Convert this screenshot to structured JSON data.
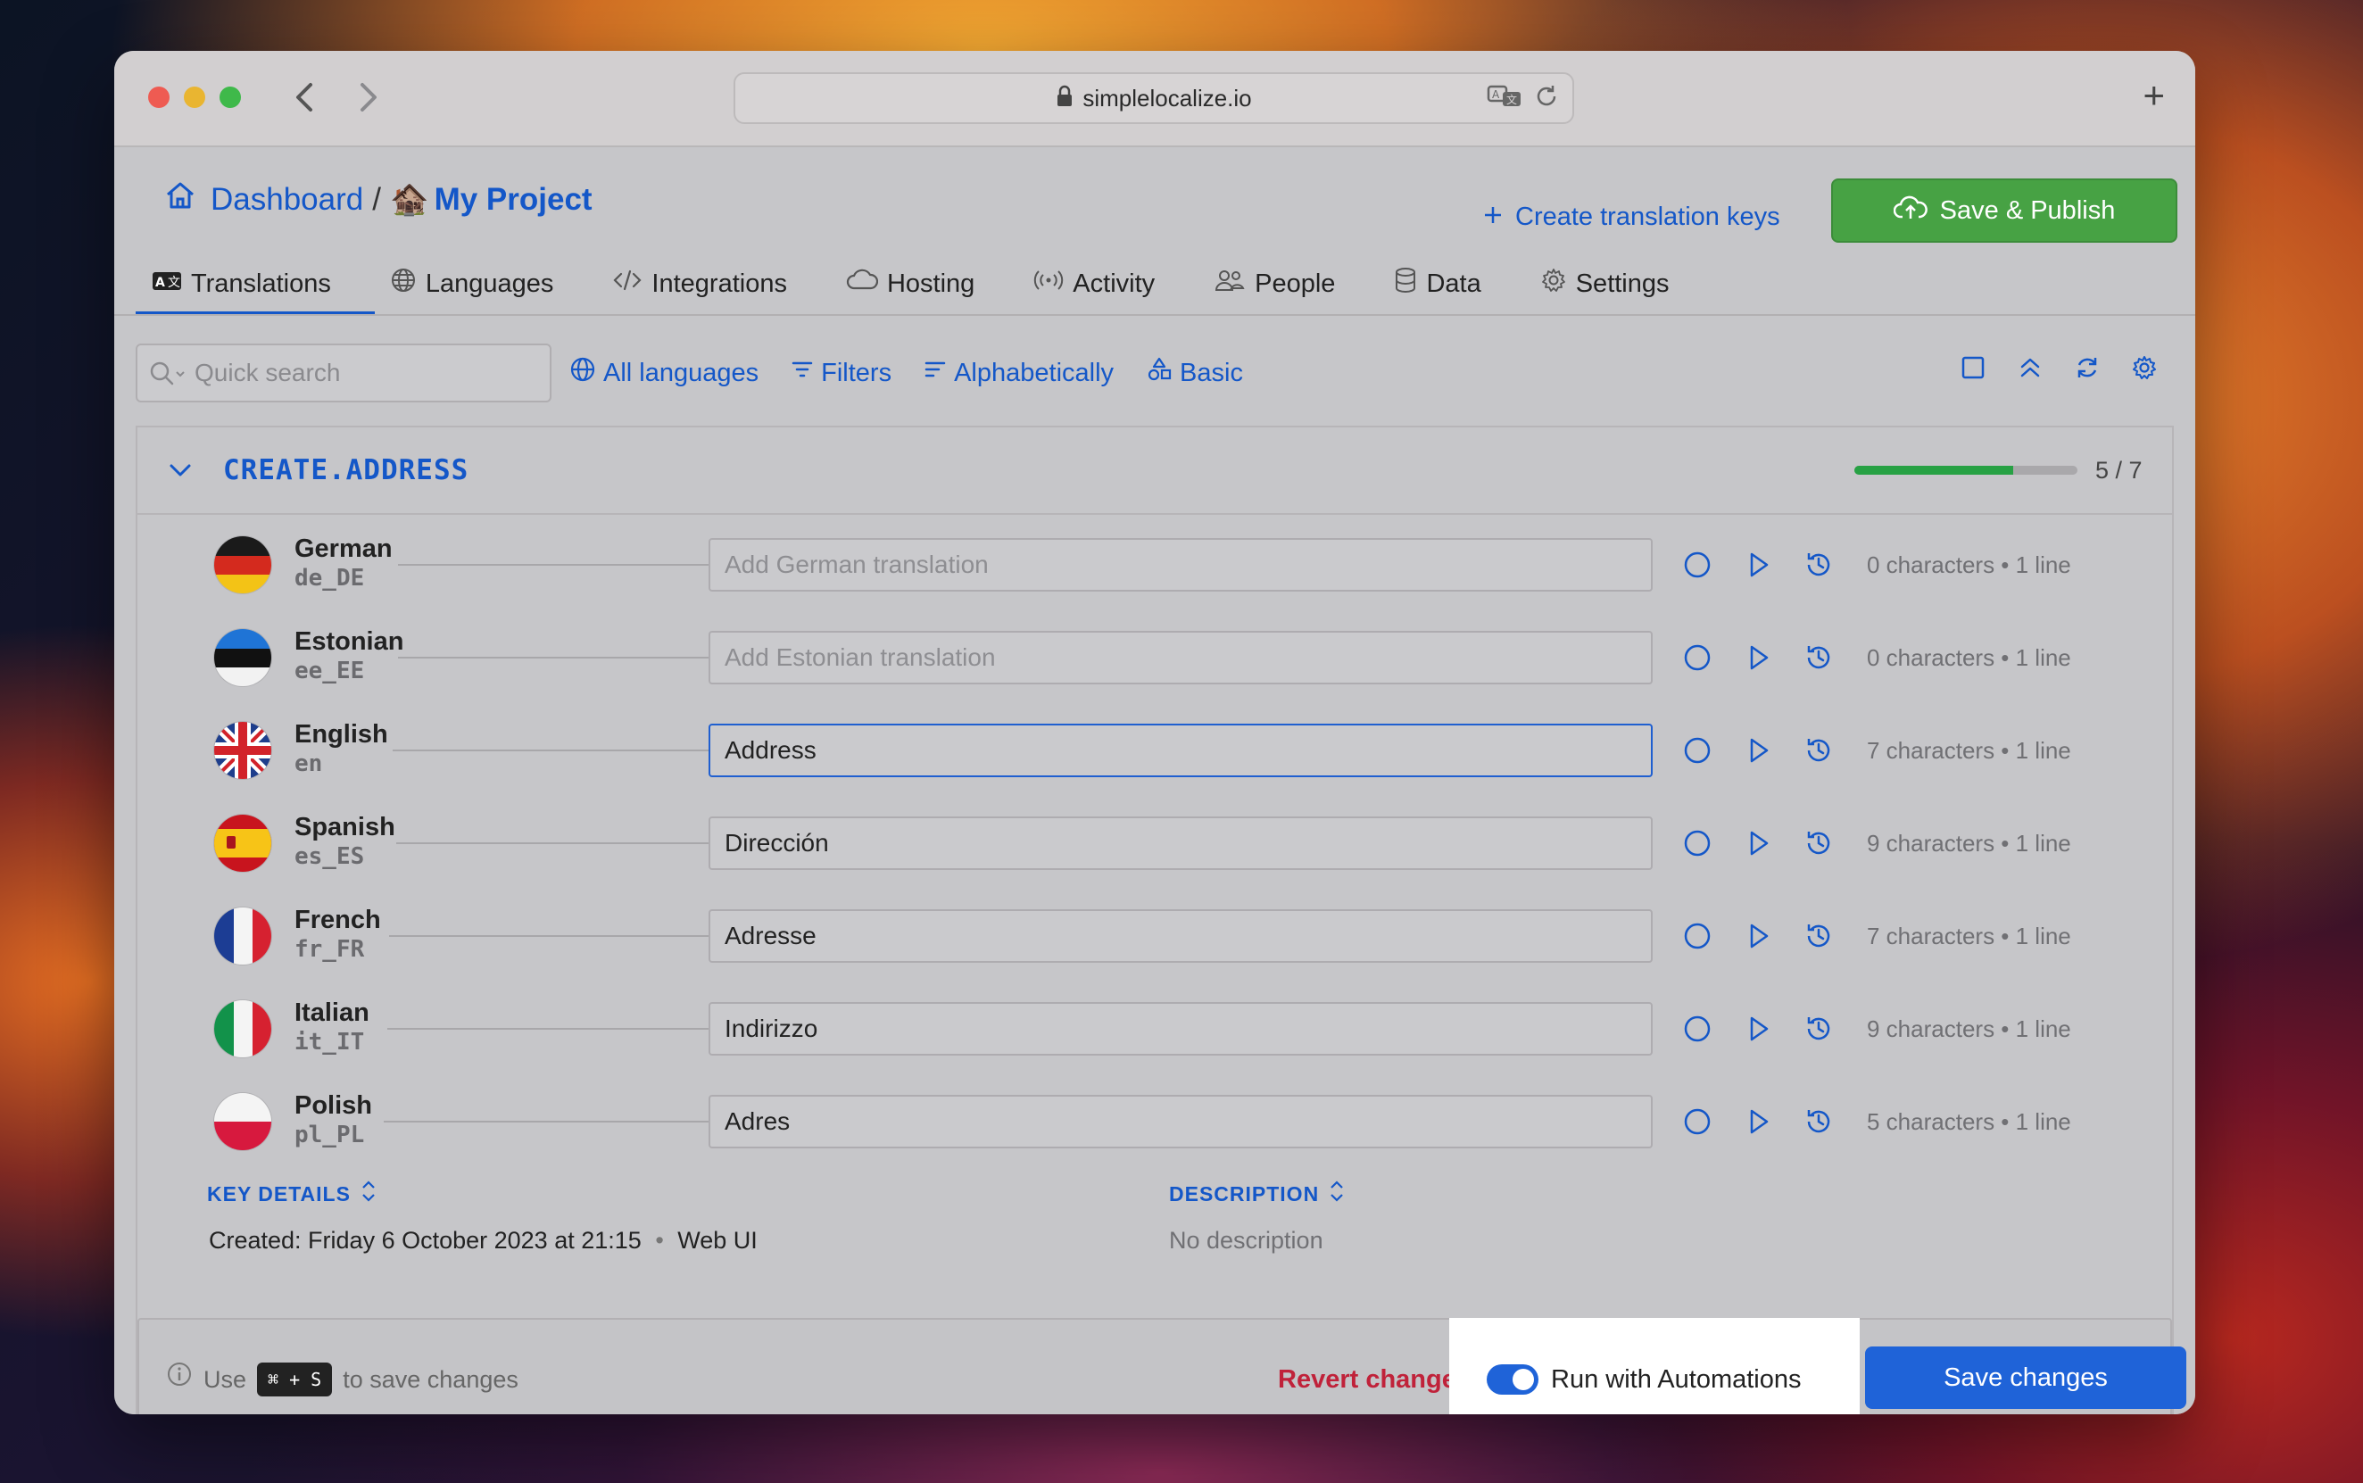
{
  "browser": {
    "url": "simplelocalize.io",
    "back_icon": "chevron-left-icon",
    "forward_icon": "chevron-right-icon",
    "new_tab": "+"
  },
  "header": {
    "dashboard": "Dashboard",
    "separator": "/",
    "project_emoji": "🏚️",
    "project": "My Project",
    "create_keys": "Create translation keys",
    "save_publish": "Save & Publish"
  },
  "tabs": [
    {
      "label": "Translations",
      "icon": "translate-icon"
    },
    {
      "label": "Languages",
      "icon": "globe-icon"
    },
    {
      "label": "Integrations",
      "icon": "code-icon"
    },
    {
      "label": "Hosting",
      "icon": "cloud-icon"
    },
    {
      "label": "Activity",
      "icon": "broadcast-icon"
    },
    {
      "label": "People",
      "icon": "people-icon"
    },
    {
      "label": "Data",
      "icon": "database-icon"
    },
    {
      "label": "Settings",
      "icon": "gear-icon"
    }
  ],
  "toolbar": {
    "search_placeholder": "Quick search",
    "all_languages": "All languages",
    "filters": "Filters",
    "sort": "Alphabetically",
    "view": "Basic"
  },
  "key": {
    "name": "CREATE.ADDRESS",
    "progress_text": "5 / 7",
    "progress_fraction": 0.71
  },
  "languages": [
    {
      "name": "German",
      "code": "de_DE",
      "value": "",
      "placeholder": "Add German translation",
      "chars": "0 characters • 1 line",
      "flag": "de"
    },
    {
      "name": "Estonian",
      "code": "ee_EE",
      "value": "",
      "placeholder": "Add Estonian translation",
      "chars": "0 characters • 1 line",
      "flag": "ee"
    },
    {
      "name": "English",
      "code": "en",
      "value": "Address",
      "placeholder": "",
      "chars": "7 characters • 1 line",
      "flag": "gb"
    },
    {
      "name": "Spanish",
      "code": "es_ES",
      "value": "Dirección",
      "placeholder": "",
      "chars": "9 characters • 1 line",
      "flag": "es"
    },
    {
      "name": "French",
      "code": "fr_FR",
      "value": "Adresse",
      "placeholder": "",
      "chars": "7 characters • 1 line",
      "flag": "fr"
    },
    {
      "name": "Italian",
      "code": "it_IT",
      "value": "Indirizzo",
      "placeholder": "",
      "chars": "9 characters • 1 line",
      "flag": "it"
    },
    {
      "name": "Polish",
      "code": "pl_PL",
      "value": "Adres",
      "placeholder": "",
      "chars": "5 characters • 1 line",
      "flag": "pl"
    }
  ],
  "details": {
    "key_details_label": "KEY DETAILS",
    "description_label": "DESCRIPTION",
    "created": "Created: Friday 6 October 2023 at 21:15",
    "created_sep": "•",
    "created_by": "Web UI",
    "description": "No description"
  },
  "footer": {
    "hint_pre": "Use",
    "hint_kbd": "⌘ + S",
    "hint_post": "to save changes",
    "revert": "Revert changes",
    "automation": "Run with Automations",
    "save": "Save changes"
  },
  "colors": {
    "accent": "#1457c8",
    "publish": "#47a244",
    "revert": "#c0223a",
    "progress": "#27a144"
  }
}
